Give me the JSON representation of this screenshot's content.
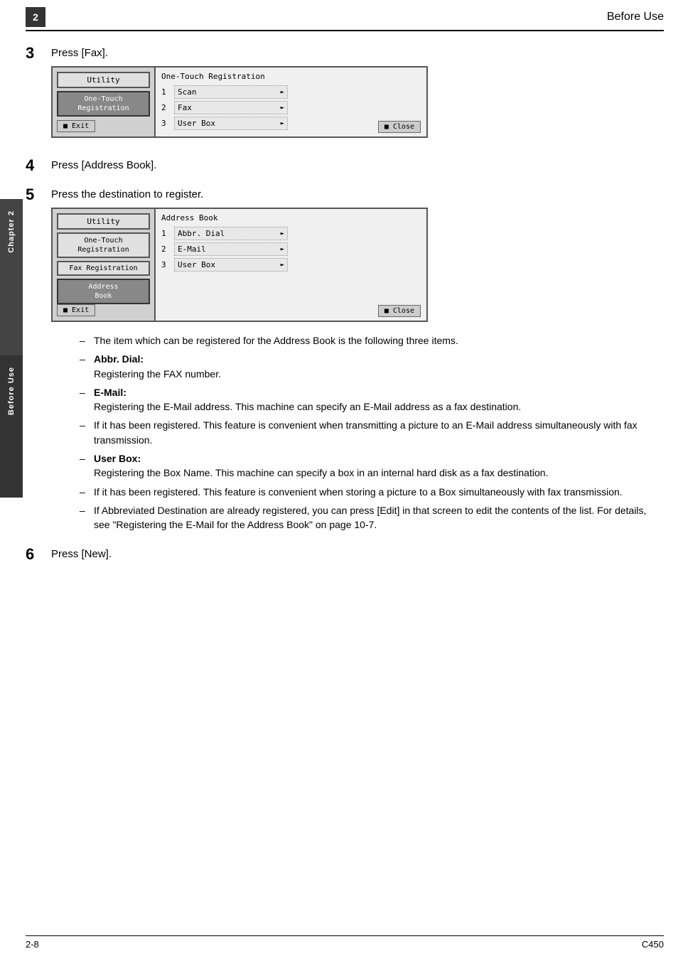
{
  "header": {
    "chapter_num": "2",
    "title": "Before Use"
  },
  "side_label": {
    "chapter_text": "Chapter 2",
    "section_text": "Before Use"
  },
  "footer": {
    "page_num": "2-8",
    "model": "C450"
  },
  "steps": [
    {
      "num": "3",
      "label": "Press [Fax].",
      "has_screenshot": true,
      "screenshot_id": "fax_screen"
    },
    {
      "num": "4",
      "label": "Press [Address Book].",
      "has_screenshot": false
    },
    {
      "num": "5",
      "label": "Press the destination to register.",
      "has_screenshot": true,
      "screenshot_id": "address_screen"
    },
    {
      "num": "6",
      "label": "Press [New].",
      "has_screenshot": false
    }
  ],
  "fax_screen": {
    "left_buttons": [
      "Utility",
      "One-Touch\nRegistration"
    ],
    "active_button": "One-Touch\nRegistration",
    "exit_button": "Exit",
    "close_button": "Close",
    "right_title": "One-Touch Registration",
    "right_items": [
      {
        "num": "1",
        "label": "Scan"
      },
      {
        "num": "2",
        "label": "Fax"
      },
      {
        "num": "3",
        "label": "User Box"
      }
    ]
  },
  "address_screen": {
    "left_buttons": [
      "Utility",
      "One-Touch\nRegistration",
      "Fax Registration",
      "Address\nBook"
    ],
    "active_button": "Address\nBook",
    "exit_button": "Exit",
    "close_button": "Close",
    "right_title": "Address Book",
    "right_items": [
      {
        "num": "1",
        "label": "Abbr. Dial"
      },
      {
        "num": "2",
        "label": "E-Mail"
      },
      {
        "num": "3",
        "label": "User Box"
      }
    ]
  },
  "bullets": [
    {
      "dash": "–",
      "text": "The item which can be registered for the Address Book is the following three items."
    },
    {
      "dash": "–",
      "text": "Abbr. Dial:\nRegistering the FAX number."
    },
    {
      "dash": "–",
      "text": "E-Mail:\nRegistering the E-Mail address. This machine can specify an E-Mail address as a fax destination."
    },
    {
      "dash": "–",
      "text": "If it has been registered. This feature is convenient when transmitting a picture to an E-Mail address simultaneously with fax transmission."
    },
    {
      "dash": "–",
      "text": "User Box:\nRegistering the Box Name. This machine can specify a box in an internal hard disk as a fax destination."
    },
    {
      "dash": "–",
      "text": "If it has been registered. This feature is convenient when storing a picture to a Box simultaneously with fax transmission."
    },
    {
      "dash": "–",
      "text": "If Abbreviated Destination are already registered, you can press [Edit] in that screen to edit the contents of the list. For details, see \"Registering the E-Mail for the Address Book\" on page 10-7."
    }
  ]
}
